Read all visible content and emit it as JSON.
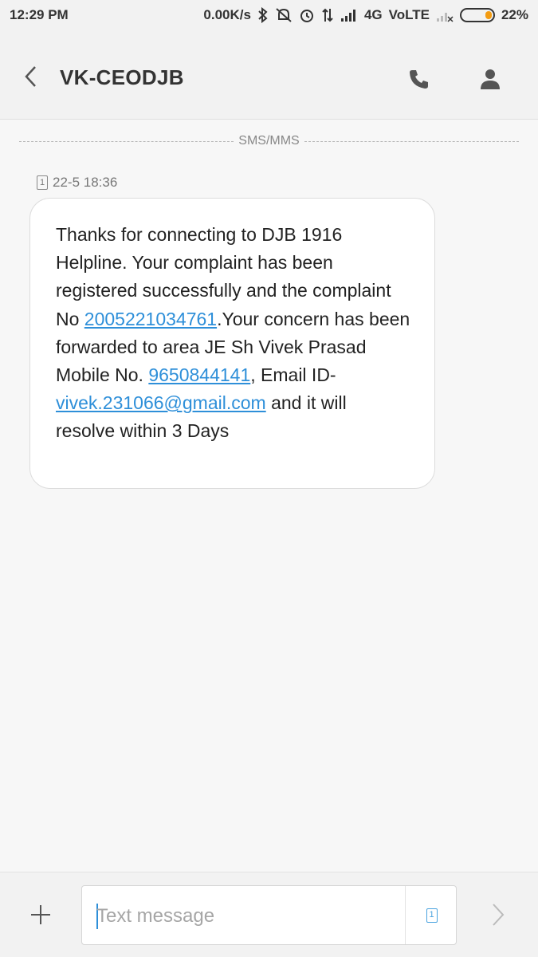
{
  "status_bar": {
    "time": "12:29 PM",
    "net_speed": "0.00K/s",
    "network": "4G",
    "volte": "VoLTE",
    "battery_percent": "22%",
    "battery_level": 0.22,
    "icons": [
      "bluetooth-icon",
      "mute-icon",
      "alarm-icon",
      "data-transfer-icon",
      "signal-icon",
      "signal-off-icon",
      "battery-icon"
    ]
  },
  "header": {
    "title": "VK-CEODJB",
    "icons": [
      "back-icon",
      "phone-icon",
      "contact-icon"
    ]
  },
  "thread": {
    "divider_label": "SMS/MMS",
    "message": {
      "sim_label": "1",
      "timestamp": "22-5 18:36",
      "text_1": "Thanks for connecting to DJB 1916 Helpline. Your complaint has been registered successfully and the complaint No  ",
      "complaint_no": "2005221034761",
      "text_2": ".Your concern has been forwarded to area JE Sh Vivek Prasad Mobile No. ",
      "mobile_no": "9650844141",
      "text_3": ", Email ID- ",
      "email": "vivek.231066@gmail.com",
      "text_4": " and it will resolve within 3 Days"
    }
  },
  "input_bar": {
    "placeholder": "Text message",
    "sim_label": "1",
    "icons": [
      "plus-icon",
      "sim-icon",
      "send-icon"
    ]
  },
  "colors": {
    "link": "#2e8fd9",
    "battery": "#f39c12",
    "background": "#f7f7f7"
  }
}
